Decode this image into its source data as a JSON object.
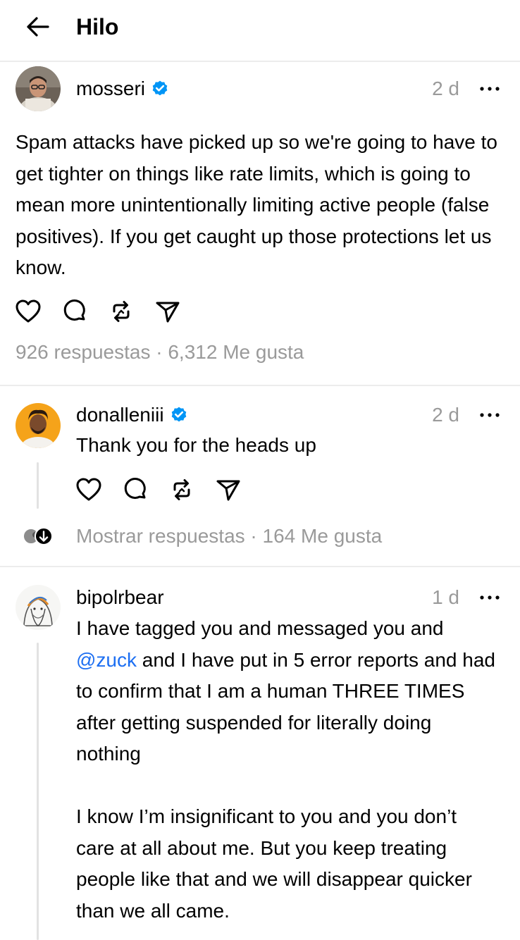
{
  "header": {
    "title": "Hilo",
    "back_icon": "arrow-left-icon"
  },
  "main_post": {
    "username": "mosseri",
    "verified": true,
    "time": "2 d",
    "text": "Spam attacks have picked up so we're going to have to get tighter on things like rate limits, which is going to mean more unintentionally limiting active people (false positives). If you get caught up those protections let us know.",
    "replies": "926 respuestas",
    "separator": "·",
    "likes": "6,312 Me gusta"
  },
  "reply1": {
    "username": "donalleniii",
    "verified": true,
    "time": "2 d",
    "text": "Thank you for the heads up",
    "show_replies": "Mostrar respuestas",
    "separator": "·",
    "likes": "164 Me gusta"
  },
  "reply2": {
    "username": "bipolrbear",
    "time": "1 d",
    "text_before_mention": "I have tagged you and messaged you and",
    "mention": "@zuck",
    "text_after_mention": " and I have put in 5 error reports and had to confirm that I am a human THREE TIMES after getting suspended for literally doing nothing\n\nI know I’m insignificant to you and you don’t care at all about me. But you keep treating people like that and we will disappear quicker than we all came."
  },
  "icons": [
    "heart-icon",
    "comment-icon",
    "repost-icon",
    "share-icon",
    "more-icon",
    "verified-icon"
  ],
  "colors": {
    "verified": "#0095f6",
    "mention": "#1d6ff2",
    "muted": "#9a9a9a"
  }
}
